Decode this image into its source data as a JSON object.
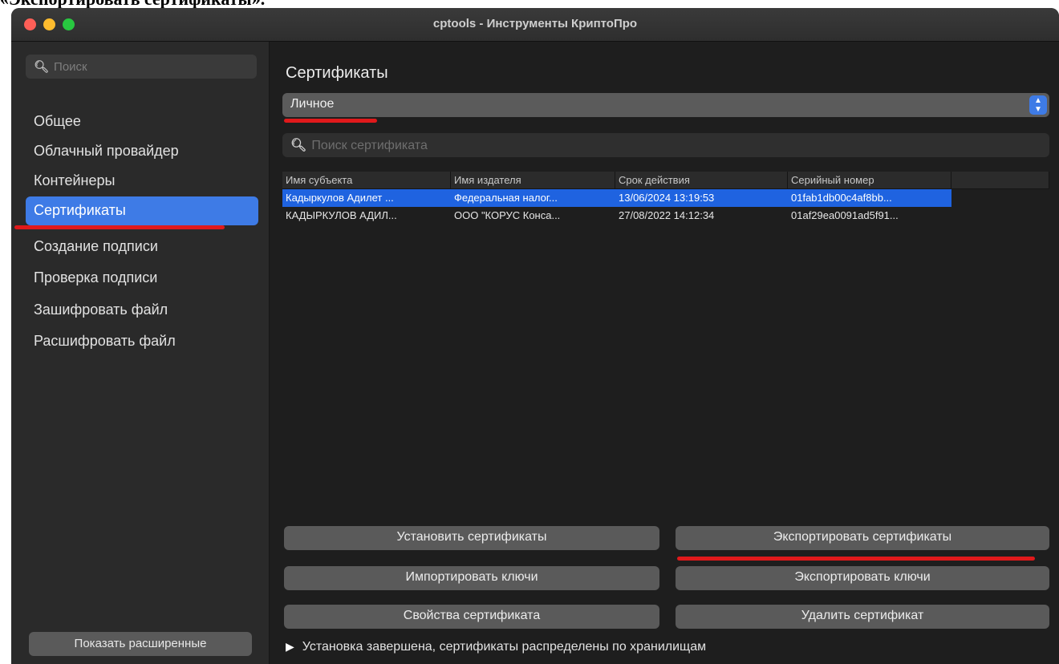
{
  "doc_caption": "«Экспортировать сертификаты».",
  "window": {
    "title": "cptools - Инструменты КриптоПро"
  },
  "sidebar": {
    "search_placeholder": "Поиск",
    "items": [
      {
        "label": "Общее"
      },
      {
        "label": "Облачный провайдер"
      },
      {
        "label": "Контейнеры"
      },
      {
        "label": "Сертификаты",
        "active": true
      },
      {
        "label": "Создание подписи"
      },
      {
        "label": "Проверка подписи"
      },
      {
        "label": "Зашифровать файл"
      },
      {
        "label": "Расшифровать файл"
      }
    ],
    "show_advanced_label": "Показать расширенные"
  },
  "main": {
    "title": "Сертификаты",
    "store_select": "Личное",
    "cert_search_placeholder": "Поиск сертификата",
    "table": {
      "columns": [
        "Имя субъекта",
        "Имя издателя",
        "Срок действия",
        "Серийный номер"
      ],
      "rows": [
        {
          "subject": "Кадыркулов Адилет ...",
          "issuer": "Федеральная налог...",
          "validity": "13/06/2024 13:19:53",
          "serial": "01fab1db00c4af8bb...",
          "selected": true
        },
        {
          "subject": "КАДЫРКУЛОВ АДИЛ...",
          "issuer": "ООО \"КОРУС Конса...",
          "validity": "27/08/2022 14:12:34",
          "serial": "01af29ea0091ad5f91...",
          "selected": false
        }
      ]
    },
    "buttons": {
      "install_certs": "Установить сертификаты",
      "export_certs": "Экспортировать сертификаты",
      "import_keys": "Импортировать ключи",
      "export_keys": "Экспортировать ключи",
      "cert_properties": "Свойства сертификата",
      "delete_cert": "Удалить сертификат"
    },
    "status": "Установка завершена, сертификаты распределены по хранилищам"
  },
  "colors": {
    "accent": "#3e7be6",
    "selection": "#1f63e0",
    "annotation_red": "#e0191b",
    "window_bg": "#1e1e1e",
    "sidebar_bg": "#2a2a2a"
  },
  "icons": [
    "close-light",
    "minimize-light",
    "zoom-light",
    "search-icon",
    "stepper-icon",
    "disclosure-triangle-icon"
  ]
}
